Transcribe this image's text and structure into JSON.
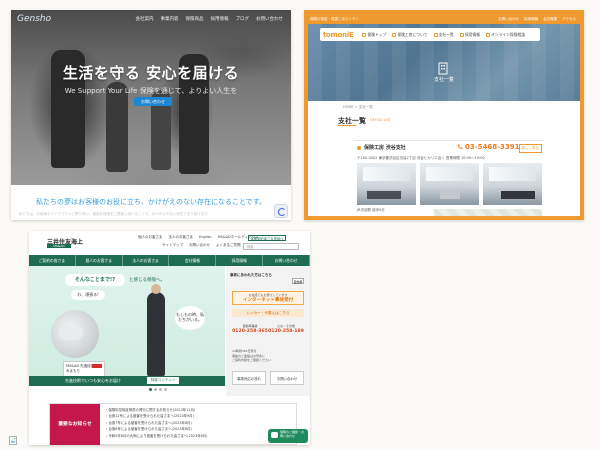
{
  "panel1": {
    "logo": "Gensho",
    "nav": [
      "会社案内",
      "事業内容",
      "保険商品",
      "採用情報",
      "ブログ",
      "お問い合わせ"
    ],
    "hero_title": "生活を守る 安心を届ける",
    "hero_sub": "We Support Your Life  保険を通じて、よりよい人生を",
    "hero_button": "お問い合わせ",
    "tagline": "私たちの夢はお客様のお役に立ち、かけがえのない存在になることです。",
    "footer_text": "私たちは、お客様のライフプランに寄り添い、最適な保険をご提案し続けることで、かけがえのない存在であり続けます。"
  },
  "panel2": {
    "topbar_left": "保険の相談・見直しならトモニ",
    "topbar_right": [
      "お問い合わせ",
      "採用情報",
      "会社概要",
      "アクセス"
    ],
    "brand": "tomoniE",
    "menu": [
      "保険トップ",
      "保険工房について",
      "支社一覧",
      "採用情報",
      "オンライン保険相談"
    ],
    "hero_caption": "支社一覧",
    "breadcrumb": "HOME > 支社一覧",
    "heading": "支社一覧",
    "heading_sub": "OFFICE LIST",
    "office_name": "保険工房 渋谷支社",
    "phone": "03-5468-3391",
    "more": "詳しく見る",
    "address": "〒150-0002 東京都渋谷区渋谷2丁目 渋谷ヒカリエ近く 営業時間 10:00〜19:00",
    "aux": "JR渋谷駅 徒歩5分"
  },
  "panel3": {
    "logo": "三井住友海上",
    "logo_sub": "MS&AD",
    "links1": [
      "個人のお客さま",
      "法人のお客さま",
      "English",
      "MS&ADホールディングス"
    ],
    "links2": [
      "サイトマップ",
      "お問い合わせ",
      "よくあるご質問"
    ],
    "account": "保険契約者さま専用ページ",
    "search_placeholder": "検索",
    "gnav": [
      "ご契約の皆さま",
      "個人のお客さま",
      "法人のお客さま",
      "会社情報",
      "採用情報",
      "お問い合わせ"
    ],
    "bubble": "そんなことまで!?",
    "bubble2": "と感じる保険へ。",
    "c1": "わ、頑張る!",
    "c2": "もしもの時、私たちがいる。",
    "ad_text": "MS&AD 先進技術 × みまもり",
    "bar_text": "先進技術でいつも安心をお届け",
    "bar_button": "特設コンテンツ",
    "side_note": "事故にあわれた方はこちら",
    "side_select": "自動車",
    "orange_small": "お電話でもお受けしています",
    "orange_big": "インターネット事故受付",
    "pill": "レッカー・代替えはこちら",
    "tel_left_label": "自動車事故",
    "tel_left": "0120-258-365",
    "tel_right_label": "火災・その他",
    "tel_right": "0120-258-189",
    "bullets": [
      "24時間365日受付",
      "事故のご連絡はお早めに",
      "ご契約内容をご確認ください"
    ],
    "mini_left": "事故対応の流れ",
    "mini_right": "お問い合わせ",
    "ann_label": "重要なお知らせ",
    "ann_items": [
      "保険料控除証明書の発行に関するお知らせ(2023年11月)",
      "台風12号による被害を受けられた皆さまへ(2023年9月)",
      "台風7号による被害を受けられた皆さまへ(2023年8月)",
      "台風6号による被害を受けられた皆さまへ(2023年8月)",
      "令和5年6月の大雨により被害を受けられた皆さまへ(2023年6月)"
    ],
    "chat": "保険のご相談・お問い合わせ"
  }
}
